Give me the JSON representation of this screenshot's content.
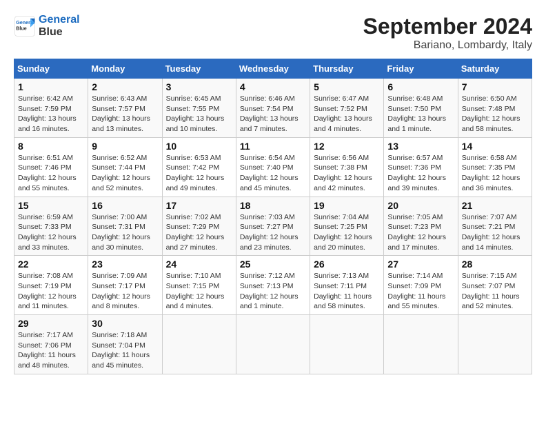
{
  "logo": {
    "line1": "General",
    "line2": "Blue"
  },
  "title": "September 2024",
  "subtitle": "Bariano, Lombardy, Italy",
  "days_of_week": [
    "Sunday",
    "Monday",
    "Tuesday",
    "Wednesday",
    "Thursday",
    "Friday",
    "Saturday"
  ],
  "weeks": [
    [
      {
        "num": "1",
        "info": "Sunrise: 6:42 AM\nSunset: 7:59 PM\nDaylight: 13 hours\nand 16 minutes."
      },
      {
        "num": "2",
        "info": "Sunrise: 6:43 AM\nSunset: 7:57 PM\nDaylight: 13 hours\nand 13 minutes."
      },
      {
        "num": "3",
        "info": "Sunrise: 6:45 AM\nSunset: 7:55 PM\nDaylight: 13 hours\nand 10 minutes."
      },
      {
        "num": "4",
        "info": "Sunrise: 6:46 AM\nSunset: 7:54 PM\nDaylight: 13 hours\nand 7 minutes."
      },
      {
        "num": "5",
        "info": "Sunrise: 6:47 AM\nSunset: 7:52 PM\nDaylight: 13 hours\nand 4 minutes."
      },
      {
        "num": "6",
        "info": "Sunrise: 6:48 AM\nSunset: 7:50 PM\nDaylight: 13 hours\nand 1 minute."
      },
      {
        "num": "7",
        "info": "Sunrise: 6:50 AM\nSunset: 7:48 PM\nDaylight: 12 hours\nand 58 minutes."
      }
    ],
    [
      {
        "num": "8",
        "info": "Sunrise: 6:51 AM\nSunset: 7:46 PM\nDaylight: 12 hours\nand 55 minutes."
      },
      {
        "num": "9",
        "info": "Sunrise: 6:52 AM\nSunset: 7:44 PM\nDaylight: 12 hours\nand 52 minutes."
      },
      {
        "num": "10",
        "info": "Sunrise: 6:53 AM\nSunset: 7:42 PM\nDaylight: 12 hours\nand 49 minutes."
      },
      {
        "num": "11",
        "info": "Sunrise: 6:54 AM\nSunset: 7:40 PM\nDaylight: 12 hours\nand 45 minutes."
      },
      {
        "num": "12",
        "info": "Sunrise: 6:56 AM\nSunset: 7:38 PM\nDaylight: 12 hours\nand 42 minutes."
      },
      {
        "num": "13",
        "info": "Sunrise: 6:57 AM\nSunset: 7:36 PM\nDaylight: 12 hours\nand 39 minutes."
      },
      {
        "num": "14",
        "info": "Sunrise: 6:58 AM\nSunset: 7:35 PM\nDaylight: 12 hours\nand 36 minutes."
      }
    ],
    [
      {
        "num": "15",
        "info": "Sunrise: 6:59 AM\nSunset: 7:33 PM\nDaylight: 12 hours\nand 33 minutes."
      },
      {
        "num": "16",
        "info": "Sunrise: 7:00 AM\nSunset: 7:31 PM\nDaylight: 12 hours\nand 30 minutes."
      },
      {
        "num": "17",
        "info": "Sunrise: 7:02 AM\nSunset: 7:29 PM\nDaylight: 12 hours\nand 27 minutes."
      },
      {
        "num": "18",
        "info": "Sunrise: 7:03 AM\nSunset: 7:27 PM\nDaylight: 12 hours\nand 23 minutes."
      },
      {
        "num": "19",
        "info": "Sunrise: 7:04 AM\nSunset: 7:25 PM\nDaylight: 12 hours\nand 20 minutes."
      },
      {
        "num": "20",
        "info": "Sunrise: 7:05 AM\nSunset: 7:23 PM\nDaylight: 12 hours\nand 17 minutes."
      },
      {
        "num": "21",
        "info": "Sunrise: 7:07 AM\nSunset: 7:21 PM\nDaylight: 12 hours\nand 14 minutes."
      }
    ],
    [
      {
        "num": "22",
        "info": "Sunrise: 7:08 AM\nSunset: 7:19 PM\nDaylight: 12 hours\nand 11 minutes."
      },
      {
        "num": "23",
        "info": "Sunrise: 7:09 AM\nSunset: 7:17 PM\nDaylight: 12 hours\nand 8 minutes."
      },
      {
        "num": "24",
        "info": "Sunrise: 7:10 AM\nSunset: 7:15 PM\nDaylight: 12 hours\nand 4 minutes."
      },
      {
        "num": "25",
        "info": "Sunrise: 7:12 AM\nSunset: 7:13 PM\nDaylight: 12 hours\nand 1 minute."
      },
      {
        "num": "26",
        "info": "Sunrise: 7:13 AM\nSunset: 7:11 PM\nDaylight: 11 hours\nand 58 minutes."
      },
      {
        "num": "27",
        "info": "Sunrise: 7:14 AM\nSunset: 7:09 PM\nDaylight: 11 hours\nand 55 minutes."
      },
      {
        "num": "28",
        "info": "Sunrise: 7:15 AM\nSunset: 7:07 PM\nDaylight: 11 hours\nand 52 minutes."
      }
    ],
    [
      {
        "num": "29",
        "info": "Sunrise: 7:17 AM\nSunset: 7:06 PM\nDaylight: 11 hours\nand 48 minutes."
      },
      {
        "num": "30",
        "info": "Sunrise: 7:18 AM\nSunset: 7:04 PM\nDaylight: 11 hours\nand 45 minutes."
      },
      null,
      null,
      null,
      null,
      null
    ]
  ]
}
